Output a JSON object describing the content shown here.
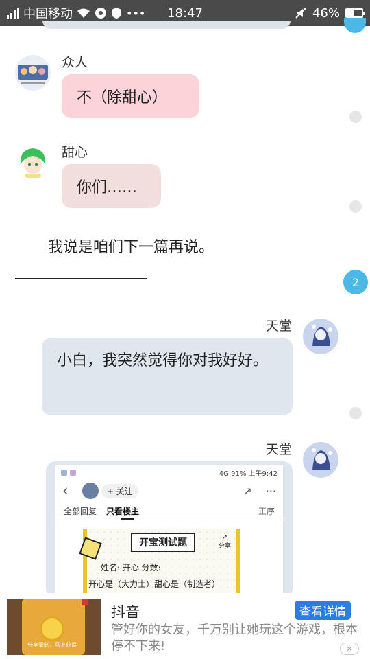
{
  "status_bar": {
    "carrier": "中国移动",
    "time": "18:47",
    "battery": "46%",
    "battery_level": 0.46
  },
  "messages": [
    {
      "sender": "众人",
      "text": "不（除甜心）"
    },
    {
      "sender": "甜心",
      "text": "你们……"
    },
    {
      "text": "我说是咱们下一篇再说。"
    },
    {
      "sender": "天堂",
      "text": "小白，我突然觉得你对我好好。"
    },
    {
      "sender": "天堂",
      "type": "image"
    }
  ],
  "unread_count": "2",
  "embedded_screenshot": {
    "status_signal": "4G",
    "status_battery": "91%",
    "status_time": "上午9:42",
    "follow_label": "+ 关注",
    "tab_all": "全部回复",
    "tab_owner": "只看楼主",
    "sort_label": "正序",
    "quiz_title": "开宝测试题",
    "share_label": "分享",
    "line1": "姓名: 开心        分数:",
    "line2": "开心是（大力士）甜心是（制造者）"
  },
  "ad": {
    "title": "抖音",
    "button": "查看详情",
    "description": "管好你的女友，千万别让她玩这个游戏，根本停不下来!",
    "thumb_caption": "分享录制，马上获得",
    "close": "✕"
  }
}
